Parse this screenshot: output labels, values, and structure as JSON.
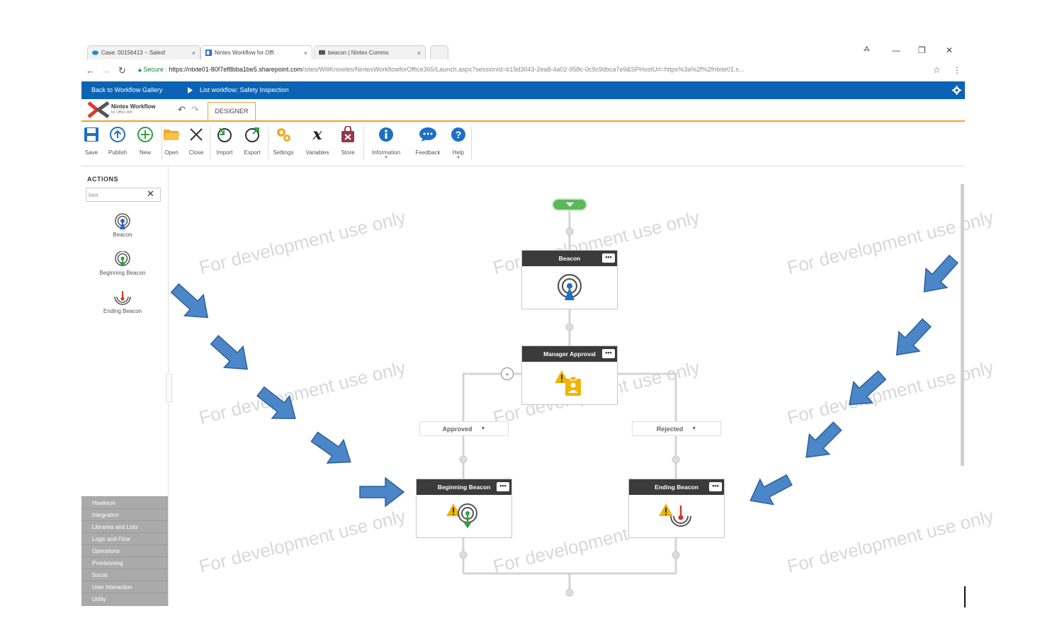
{
  "browser": {
    "tabs": [
      {
        "title": "Case: 00156413 ~ Salesf",
        "close": "×"
      },
      {
        "title": "Nintex Workflow for Offi",
        "close": "×"
      },
      {
        "title": "beacon | Nintex Commu",
        "close": "×"
      }
    ],
    "window_controls": {
      "user": "⁂",
      "minimize": "—",
      "restore": "❐",
      "close": "✕"
    },
    "url_secure_label": "Secure",
    "url_host": "https://ntxte01-80f7ef8bba1be5.sharepoint.com",
    "url_path": "/sites/WillKnowles/NintexWorkflowforOffice365/Launch.aspx?sessionId=b19d3043-2ea8-4a02-958c-0c9c9dbca7e9&SPHostUrl=https%3a%2f%2fntxte01.s..."
  },
  "breadcrumb": {
    "back": "Back to Workflow Gallery",
    "current": "List workflow: Safety Inspection"
  },
  "designer": {
    "logo_title": "Nintex Workflow",
    "logo_sub": "for Office 365",
    "tab": "DESIGNER"
  },
  "ribbon": {
    "save": "Save",
    "publish": "Publish",
    "new": "New",
    "open": "Open",
    "close": "Close",
    "import": "Import",
    "export": "Export",
    "settings": "Settings",
    "variables": "Variables",
    "store": "Store",
    "information": "Information",
    "feedback": "Feedback",
    "help": "Help"
  },
  "actions_panel": {
    "title": "ACTIONS",
    "search_value": "bea",
    "items": [
      "Beacon",
      "Beginning Beacon",
      "Ending Beacon"
    ],
    "categories": [
      "Hawkeye",
      "Integration",
      "Libraries and Lists",
      "Logic and Flow",
      "Operations",
      "Provisioning",
      "Social",
      "User Interaction",
      "Utility"
    ]
  },
  "workflow": {
    "nodes": {
      "beacon": "Beacon",
      "manager_approval": "Manager Approval",
      "beginning_beacon": "Beginning Beacon",
      "ending_beacon": "Ending Beacon",
      "menu": "•••"
    },
    "branches": {
      "approved": "Approved",
      "rejected": "Rejected"
    },
    "watermark": "For development use only"
  },
  "colors": {
    "brand_blue": "#0b63b5",
    "accent_orange": "#f0a030",
    "arrow_blue": "#4a86c8",
    "start_green": "#5cb85c"
  }
}
